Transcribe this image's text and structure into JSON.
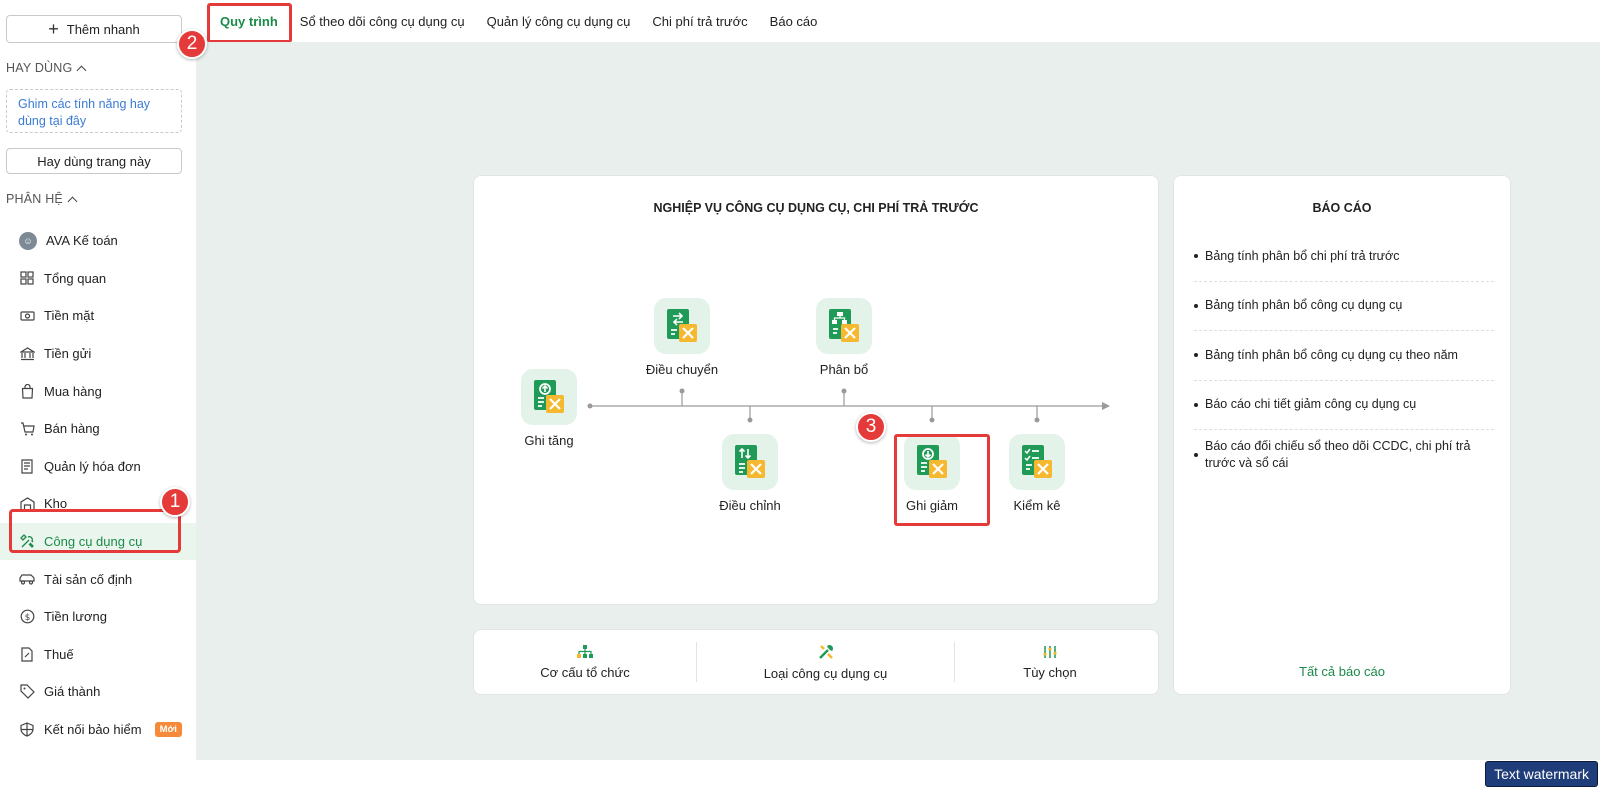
{
  "sidebar": {
    "quick_add_label": "Thêm nhanh",
    "frequent_title": "HAY DÙNG",
    "pin_hint": "Ghim các tính năng hay dùng tại đây",
    "frequent_button": "Hay dùng trang này",
    "modules_title": "PHÂN HỆ",
    "items": [
      {
        "label": "AVA Kế toán",
        "icon": "avatar"
      },
      {
        "label": "Tổng quan",
        "icon": "dashboard-icon"
      },
      {
        "label": "Tiền mặt",
        "icon": "cash-icon"
      },
      {
        "label": "Tiền gửi",
        "icon": "bank-icon"
      },
      {
        "label": "Mua hàng",
        "icon": "shopping-bag-icon"
      },
      {
        "label": "Bán hàng",
        "icon": "cart-icon"
      },
      {
        "label": "Quản lý hóa đơn",
        "icon": "invoice-icon"
      },
      {
        "label": "Kho",
        "icon": "warehouse-icon"
      },
      {
        "label": "Công cụ dụng cụ",
        "icon": "tools-icon",
        "active": true
      },
      {
        "label": "Tài sản cố định",
        "icon": "car-icon"
      },
      {
        "label": "Tiền lương",
        "icon": "dollar-icon"
      },
      {
        "label": "Thuế",
        "icon": "tax-icon"
      },
      {
        "label": "Giá thành",
        "icon": "tag-icon"
      },
      {
        "label": "Kết nối bảo hiểm",
        "icon": "shield-icon",
        "badge": "Mới"
      }
    ]
  },
  "tabs": [
    "Quy trình",
    "Sổ theo dõi công cụ dụng cụ",
    "Quản lý công cụ dụng cụ",
    "Chi phí trả trước",
    "Báo cáo"
  ],
  "flow": {
    "title": "NGHIỆP VỤ CÔNG CỤ DỤNG CỤ, CHI PHÍ TRẢ TRƯỚC",
    "nodes": {
      "ghi_tang": "Ghi tăng",
      "dieu_chuyen": "Điều chuyển",
      "phan_bo": "Phân bổ",
      "dieu_chinh": "Điều chỉnh",
      "ghi_giam": "Ghi giảm",
      "kiem_ke": "Kiểm kê"
    }
  },
  "bottom_links": {
    "org": "Cơ cấu tổ chức",
    "tool_type": "Loại công cụ dụng cụ",
    "options": "Tùy chọn"
  },
  "report": {
    "title": "BÁO CÁO",
    "items": [
      "Bảng tính phân bổ chi phí trả trước",
      "Bảng tính phân bổ công cụ dụng cụ",
      "Bảng tính phân bổ công cụ dụng cụ theo năm",
      "Báo cáo chi tiết giảm công cụ dụng cụ",
      "Báo cáo đối chiếu sổ theo dõi CCDC, chi phí trả trước và sổ cái"
    ],
    "all_link": "Tất cả báo cáo"
  },
  "callouts": [
    "1",
    "2",
    "3"
  ],
  "watermark": "Text watermark",
  "colors": {
    "accent": "#1a8a4a",
    "highlight": "#e53a3a",
    "background": "#e9efec"
  }
}
